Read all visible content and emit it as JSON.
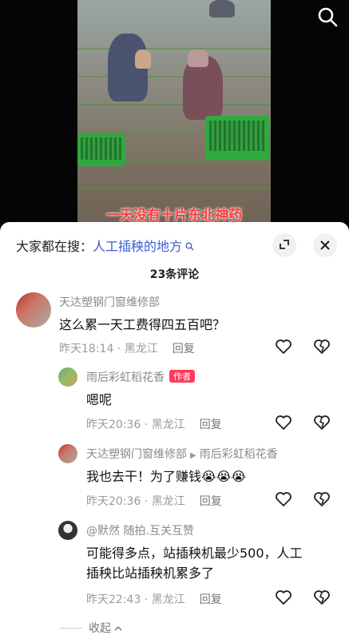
{
  "video": {
    "subtitle": "一天没有十片东北神药"
  },
  "search_hint": {
    "prefix": "大家都在搜：",
    "keyword": "人工插秧的地方"
  },
  "comments_header": {
    "count_label": "23条评论"
  },
  "comments": [
    {
      "user": "天达塑钢门窗维修部",
      "text": "这么累一天工费得四五百吧？",
      "date": "昨天18:14",
      "location": "黑龙江",
      "reply_label": "回复"
    },
    {
      "user": "雨后彩虹稻花香",
      "badge": "作者",
      "text": "嗯呢",
      "date": "昨天20:36",
      "location": "黑龙江",
      "reply_label": "回复"
    },
    {
      "user": "天达塑钢门窗维修部",
      "reply_to": "雨后彩虹稻花香",
      "text": "我也去干！为了赚钱😭😭😭",
      "date": "昨天20:36",
      "location": "黑龙江",
      "reply_label": "回复"
    },
    {
      "user": "@默然 随拍.互关互赞",
      "text_line1": "可能得多点，站插秧机最少500，人工",
      "text_line2": "插秧比站插秧机累多了",
      "date": "昨天22:43",
      "location": "黑龙江",
      "reply_label": "回复"
    }
  ],
  "footer": {
    "collapse_label": "收起"
  },
  "colors": {
    "keyword_blue": "#3a5bd0",
    "author_badge": "#ff3b5c",
    "subtitle_red": "#ff3b3b"
  },
  "icons": [
    "search-icon",
    "expand-icon",
    "close-icon",
    "heart-icon",
    "broken-heart-icon",
    "chevron-up-icon"
  ]
}
